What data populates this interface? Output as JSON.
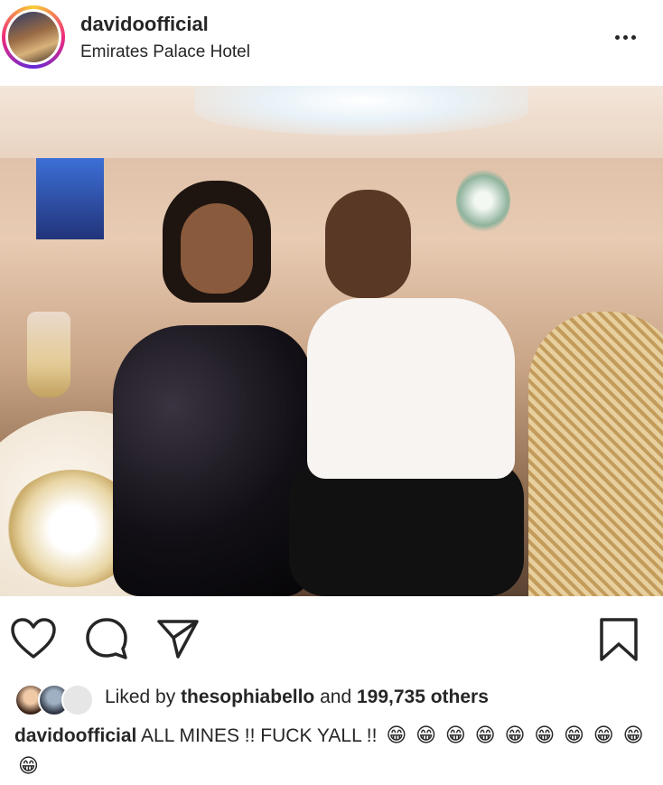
{
  "post": {
    "username": "davidoofficial",
    "location": "Emirates Palace Hotel",
    "more_icon": "more-options-icon"
  },
  "actions": {
    "icons": [
      "heart-icon",
      "comment-icon",
      "share-icon",
      "bookmark-icon"
    ]
  },
  "likes": {
    "prefix": "Liked by",
    "user": "thesophiabello",
    "conjunction": "and",
    "others": "199,735 others"
  },
  "caption": {
    "username": "davidoofficial",
    "text": "ALL MINES !! FUCK YALL !!",
    "emojis": [
      "😁",
      "😁",
      "😁",
      "😁",
      "😁",
      "😁",
      "😁",
      "😁",
      "😁",
      "😁"
    ]
  }
}
